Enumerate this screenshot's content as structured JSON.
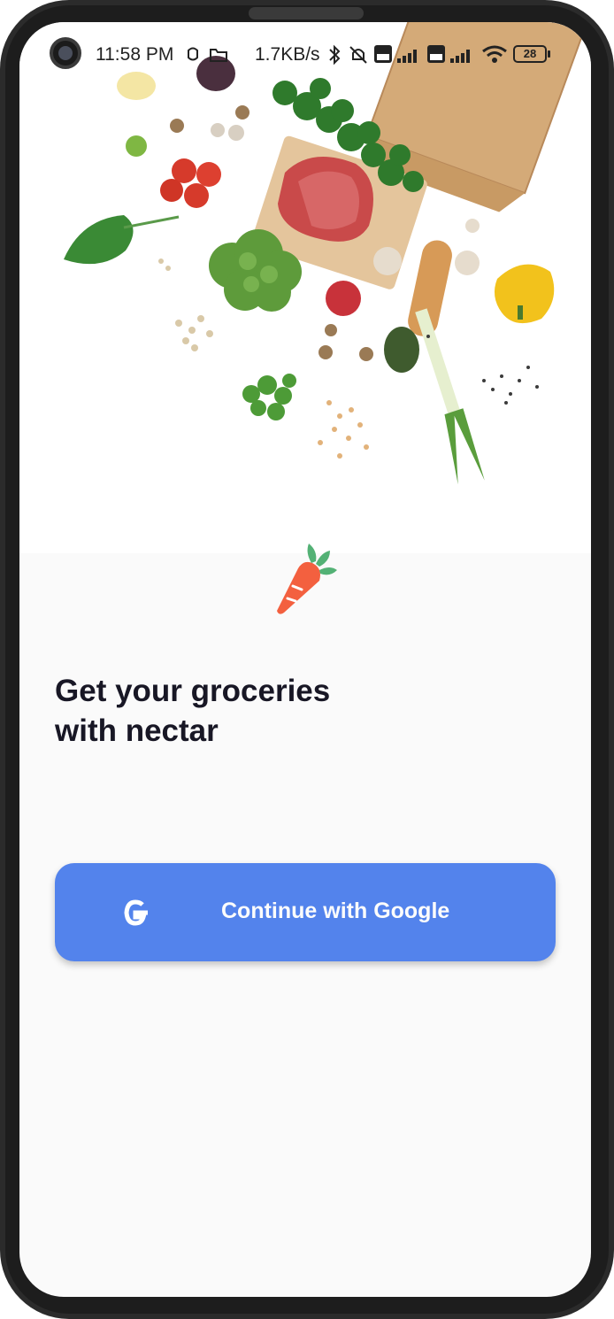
{
  "status_bar": {
    "time": "11:58 PM",
    "network_speed": "1.7KB/s",
    "battery_level": "28",
    "icons": [
      "alarm-icon",
      "folder-icon",
      "bluetooth-icon",
      "mute-icon",
      "volte-icon",
      "signal-icon",
      "volte-icon",
      "signal-icon",
      "wifi-icon",
      "battery-icon"
    ]
  },
  "hero": {
    "icon": "groceries-image"
  },
  "logo": {
    "icon": "carrot-icon",
    "colors": {
      "carrot": "#f3603f",
      "leaves": "#53b175"
    }
  },
  "headline": {
    "line1": "Get your groceries",
    "line2": "with nectar"
  },
  "google_button": {
    "label": "Continue with Google",
    "icon": "google-icon",
    "color": "#5383ec"
  }
}
